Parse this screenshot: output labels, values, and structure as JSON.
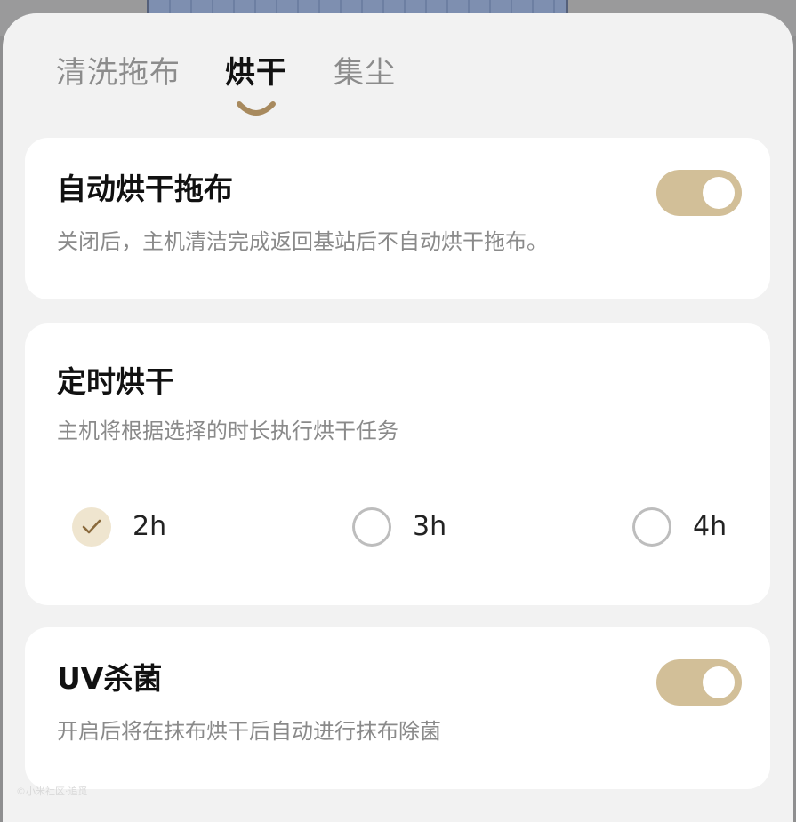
{
  "tabs": [
    {
      "label": "清洗拖布",
      "active": false
    },
    {
      "label": "烘干",
      "active": true
    },
    {
      "label": "集尘",
      "active": false
    }
  ],
  "auto_dry": {
    "title": "自动烘干拖布",
    "description": "关闭后，主机清洁完成返回基站后不自动烘干拖布。",
    "enabled": true
  },
  "timed_dry": {
    "title": "定时烘干",
    "description": "主机将根据选择的时长执行烘干任务",
    "options": [
      {
        "label": "2h",
        "selected": true
      },
      {
        "label": "3h",
        "selected": false
      },
      {
        "label": "4h",
        "selected": false
      }
    ]
  },
  "uv_sterilize": {
    "title": "UV杀菌",
    "description": "开启后将在抹布烘干后自动进行抹布除菌",
    "enabled": true
  },
  "colors": {
    "accent": "#d2bf98",
    "indicator": "#a88a5e",
    "checked_bg": "#efe5cf",
    "check_mark": "#8a6a3c"
  },
  "icons": {
    "tab_indicator": "smile-arc-icon",
    "radio_checked": "checkmark-icon"
  },
  "watermark": "©小米社区·追觅"
}
